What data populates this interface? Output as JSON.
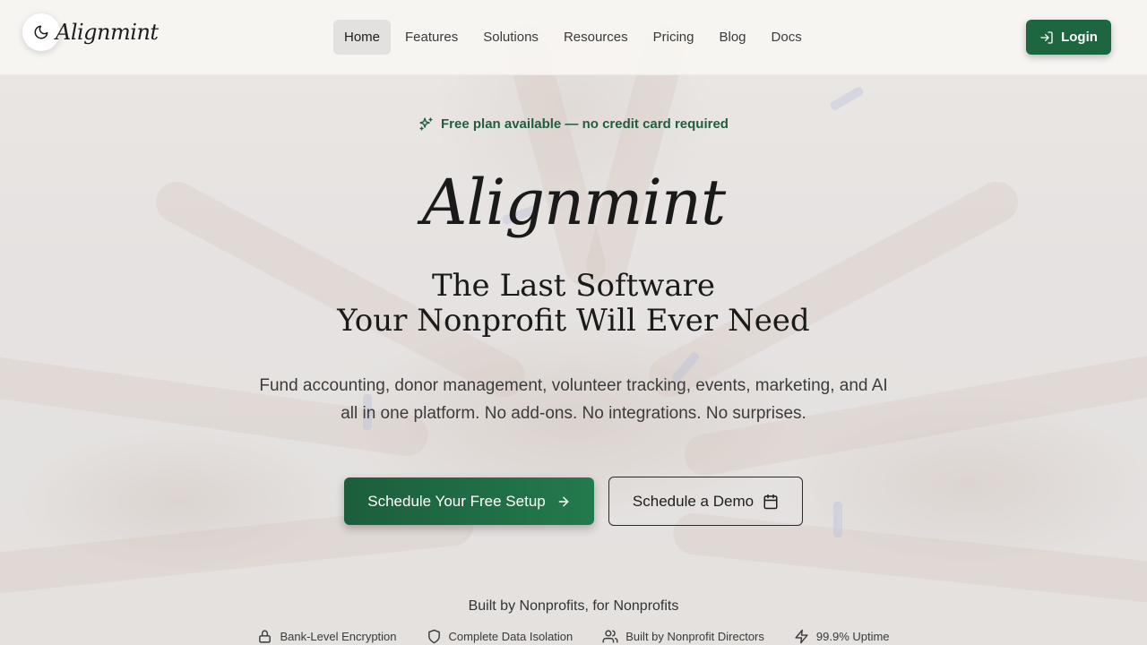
{
  "header": {
    "logo_text": "Alignmint",
    "theme_toggle_icon": "moon-icon",
    "nav": [
      {
        "label": "Home",
        "active": true
      },
      {
        "label": "Features",
        "active": false
      },
      {
        "label": "Solutions",
        "active": false
      },
      {
        "label": "Resources",
        "active": false
      },
      {
        "label": "Pricing",
        "active": false
      },
      {
        "label": "Blog",
        "active": false
      },
      {
        "label": "Docs",
        "active": false
      }
    ],
    "login_label": "Login",
    "login_icon": "login-icon"
  },
  "hero": {
    "promo_icon": "sparkles-icon",
    "promo_text": "Free plan available — no credit card required",
    "brand": "Alignmint",
    "headline_line1": "The Last Software",
    "headline_line2": "Your Nonprofit Will Ever Need",
    "sub_line1": "Fund accounting, donor management, volunteer tracking, events, marketing, and AI",
    "sub_line2": "all in one platform. No add-ons. No integrations. No surprises.",
    "cta_primary": "Schedule Your Free Setup",
    "cta_primary_icon": "arrow-right-icon",
    "cta_secondary": "Schedule a Demo",
    "cta_secondary_icon": "calendar-icon",
    "built_by": "Built by Nonprofits, for Nonprofits",
    "trust": [
      {
        "icon": "lock-icon",
        "label": "Bank-Level Encryption"
      },
      {
        "icon": "shield-icon",
        "label": "Complete Data Isolation"
      },
      {
        "icon": "users-icon",
        "label": "Built by Nonprofit Directors"
      },
      {
        "icon": "lightning-icon",
        "label": "99.9% Uptime"
      }
    ]
  },
  "colors": {
    "brand_green": "#1e6640",
    "promo_green": "#245c3e"
  }
}
